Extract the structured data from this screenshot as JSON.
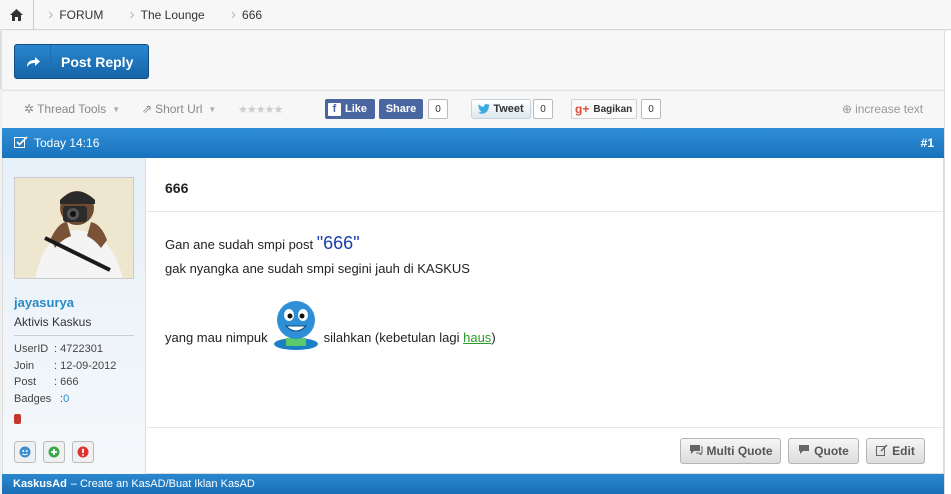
{
  "breadcrumb": {
    "items": [
      "FORUM",
      "The Lounge",
      "666"
    ]
  },
  "actions": {
    "post_reply": "Post Reply"
  },
  "toolbar": {
    "thread_tools": "Thread Tools",
    "short_url": "Short Url",
    "rating_stars": 5,
    "fb_like": "Like",
    "fb_share": "Share",
    "fb_share_count": "0",
    "tweet": "Tweet",
    "tweet_count": "0",
    "gplus": "Bagikan",
    "gplus_count": "0",
    "increase_text": "increase text"
  },
  "post": {
    "timestamp": "Today 14:16",
    "number": "#1",
    "title": "666",
    "line1_prefix": "Gan ane sudah smpi post ",
    "line1_highlight": "\"666\"",
    "line2": "gak nyangka ane sudah smpi segini jauh di KASKUS",
    "line3_prefix": "yang mau nimpuk",
    "line3_suffix_a": "silahkan (kebetulan lagi ",
    "line3_link": "haus",
    "line3_suffix_b": ")",
    "buttons": {
      "multi_quote": "Multi Quote",
      "quote": "Quote",
      "edit": "Edit"
    }
  },
  "user": {
    "username": "jayasurya",
    "title": "Aktivis Kaskus",
    "info": [
      {
        "key": "UserID",
        "value": ": 4722301"
      },
      {
        "key": "Join",
        "value": ": 12-09-2012"
      },
      {
        "key": "Post",
        "value": ": 666"
      },
      {
        "key": "Badges",
        "value": ": ",
        "link": "0"
      }
    ]
  },
  "footer": {
    "brand": "KaskusAd",
    "text": "– Create an KasAD/Buat Iklan KasAD"
  },
  "colors": {
    "accent": "#1a72bd",
    "username": "#2a8ac8",
    "highlight": "#1a3ea8",
    "link_green": "#2a9a2a"
  }
}
